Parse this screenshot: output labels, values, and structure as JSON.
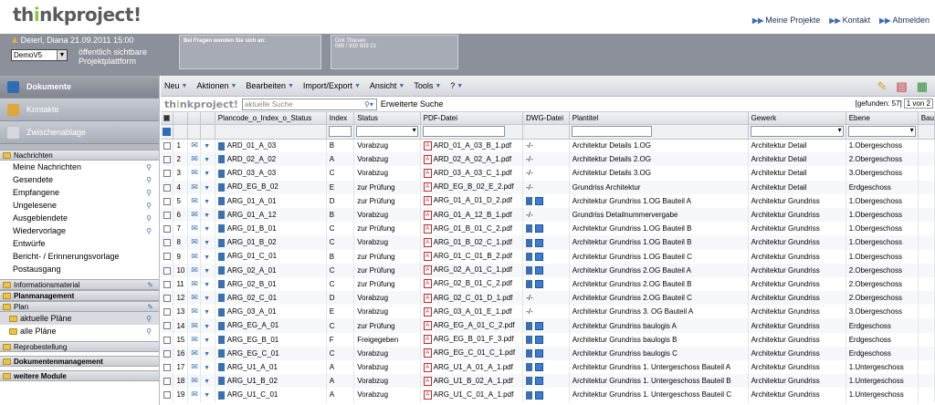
{
  "app": {
    "logo_prefix": "th",
    "logo_mid": "i",
    "logo_suffix": "nkproject!"
  },
  "top_links": [
    "Meine Projekte",
    "Kontakt",
    "Abmelden"
  ],
  "user": {
    "name": "Deierl, Diana",
    "datetime": "21.09.2011 15:00",
    "project_select": "DemoV5",
    "visibility_line1": "öffentlich sichtbare",
    "visibility_line2": "Projektplattform"
  },
  "info_boxes": {
    "questions": "Bei Fragen wenden Sie sich an:",
    "contact_name": "Dirk Thiesen",
    "contact_phone": "089 / 930 839 21"
  },
  "sidebar": {
    "big_nav": [
      {
        "label": "Dokumente",
        "active": true
      },
      {
        "label": "Kontakte",
        "active": false
      },
      {
        "label": "Zwischenablage",
        "active": false
      }
    ],
    "nachrichten": {
      "title": "Nachrichten",
      "items": [
        "Meine Nachrichten",
        "Gesendete",
        "Empfangene",
        "Ungelesene",
        "Ausgeblendete",
        "Wiedervorlage",
        "Entwürfe",
        "Bericht- / Erinnerungsvorlage",
        "Postausgang"
      ]
    },
    "sections": [
      "Informationsmaterial",
      "Planmanagement",
      "Plan"
    ],
    "plan_items": [
      "aktuelle Pläne",
      "alle Pläne"
    ],
    "bottom_sections": [
      "Reprobestellung",
      "Dokumentenmanagement",
      "weitere Module"
    ]
  },
  "menu": [
    "Neu",
    "Aktionen",
    "Bearbeiten",
    "Import/Export",
    "Ansicht",
    "Tools",
    "?"
  ],
  "search": {
    "placeholder": "aktuelle Suche",
    "advanced": "Erweiterte Suche",
    "found": "[gefunden: 57]",
    "page": "1 von 2"
  },
  "table": {
    "headers": [
      "Plancode_o_Index_o_Status",
      "Index",
      "Status",
      "PDF-Datei",
      "DWG-Datei",
      "Plantitel",
      "Gewerk",
      "Ebene",
      "Bau"
    ],
    "rows": [
      {
        "n": "1",
        "code": "ARD_01_A_03",
        "idx": "B",
        "status": "Vorabzug",
        "pdf": "ARD_01_A_03_B_1.pdf",
        "dwg": "-/-",
        "title": "Architektur Details 1.OG",
        "gewerk": "Architektur Detail",
        "ebene": "1.Obergeschoss"
      },
      {
        "n": "2",
        "code": "ARD_02_A_02",
        "idx": "A",
        "status": "Vorabzug",
        "pdf": "ARD_02_A_02_A_1.pdf",
        "dwg": "-/-",
        "title": "Architektur Details 2.OG",
        "gewerk": "Architektur Detail",
        "ebene": "2.Obergeschoss"
      },
      {
        "n": "3",
        "code": "ARD_03_A_03",
        "idx": "C",
        "status": "Vorabzug",
        "pdf": "ARD_03_A_03_C_1.pdf",
        "dwg": "-/-",
        "title": "Architektur Details 3.OG",
        "gewerk": "Architektur Detail",
        "ebene": "3.Obergeschoss"
      },
      {
        "n": "4",
        "code": "ARD_EG_B_02",
        "idx": "E",
        "status": "zur Prüfung",
        "pdf": "ARD_EG_B_02_E_2.pdf",
        "dwg": "-/-",
        "title": "Grundriss Architektur",
        "gewerk": "Architektur Detail",
        "ebene": "Erdgeschoss"
      },
      {
        "n": "5",
        "code": "ARG_01_A_01",
        "idx": "D",
        "status": "zur Prüfung",
        "pdf": "ARG_01_A_01_D_2.pdf",
        "dwg": "",
        "title": "Architektur Grundriss 1.OG Bauteil A",
        "gewerk": "Architektur Grundriss",
        "ebene": "1.Obergeschoss"
      },
      {
        "n": "6",
        "code": "ARG_01_A_12",
        "idx": "B",
        "status": "Vorabzug",
        "pdf": "ARG_01_A_12_B_1.pdf",
        "dwg": "-/-",
        "title": "Grundriss Detailnummervergabe",
        "gewerk": "Architektur Grundriss",
        "ebene": "1.Obergeschoss"
      },
      {
        "n": "7",
        "code": "ARG_01_B_01",
        "idx": "C",
        "status": "zur Prüfung",
        "pdf": "ARG_01_B_01_C_2.pdf",
        "dwg": "",
        "title": "Architektur Grundriss 1.OG Bauteil B",
        "gewerk": "Architektur Grundriss",
        "ebene": "1.Obergeschoss"
      },
      {
        "n": "8",
        "code": "ARG_01_B_02",
        "idx": "C",
        "status": "Vorabzug",
        "pdf": "ARG_01_B_02_C_1.pdf",
        "dwg": "",
        "title": "Architektur Grundriss 1.OG Bauteil B",
        "gewerk": "Architektur Grundriss",
        "ebene": "1.Obergeschoss"
      },
      {
        "n": "9",
        "code": "ARG_01_C_01",
        "idx": "B",
        "status": "zur Prüfung",
        "pdf": "ARG_01_C_01_B_2.pdf",
        "dwg": "",
        "title": "Architektur Grundriss 1.OG Bauteil C",
        "gewerk": "Architektur Grundriss",
        "ebene": "1.Obergeschoss"
      },
      {
        "n": "10",
        "code": "ARG_02_A_01",
        "idx": "C",
        "status": "zur Prüfung",
        "pdf": "ARG_02_A_01_C_1.pdf",
        "dwg": "",
        "title": "Architektur Grundriss 2.OG Bauteil A",
        "gewerk": "Architektur Grundriss",
        "ebene": "2.Obergeschoss"
      },
      {
        "n": "11",
        "code": "ARG_02_B_01",
        "idx": "C",
        "status": "zur Prüfung",
        "pdf": "ARG_02_B_01_C_2.pdf",
        "dwg": "",
        "title": "Architektur Grundriss 2.OG Bauteil B",
        "gewerk": "Architektur Grundriss",
        "ebene": "2.Obergeschoss"
      },
      {
        "n": "12",
        "code": "ARG_02_C_01",
        "idx": "D",
        "status": "Vorabzug",
        "pdf": "ARG_02_C_01_D_1.pdf",
        "dwg": "-/-",
        "title": "Architektur Grundriss 2.OG Bauteil C",
        "gewerk": "Architektur Grundriss",
        "ebene": "2.Obergeschoss"
      },
      {
        "n": "13",
        "code": "ARG_03_A_01",
        "idx": "E",
        "status": "Vorabzug",
        "pdf": "ARG_03_A_01_E_1.pdf",
        "dwg": "-/-",
        "title": "Architektur Grundriss 3. OG Bauteil A",
        "gewerk": "Architektur Grundriss",
        "ebene": "3.Obergeschoss"
      },
      {
        "n": "14",
        "code": "ARG_EG_A_01",
        "idx": "C",
        "status": "zur Prüfung",
        "pdf": "ARG_EG_A_01_C_2.pdf",
        "dwg": "",
        "title": "Architektur Grundriss baulogis A",
        "gewerk": "Architektur Grundriss",
        "ebene": "Erdgeschoss"
      },
      {
        "n": "15",
        "code": "ARG_EG_B_01",
        "idx": "F",
        "status": "Freigegeben",
        "pdf": "ARG_EG_B_01_F_3.pdf",
        "dwg": "",
        "title": "Architektur Grundriss baulogis B",
        "gewerk": "Architektur Grundriss",
        "ebene": "Erdgeschoss"
      },
      {
        "n": "16",
        "code": "ARG_EG_C_01",
        "idx": "C",
        "status": "Vorabzug",
        "pdf": "ARG_EG_C_01_C_1.pdf",
        "dwg": "",
        "title": "Architektur Grundriss baulogis C",
        "gewerk": "Architektur Grundriss",
        "ebene": "Erdgeschoss"
      },
      {
        "n": "17",
        "code": "ARG_U1_A_01",
        "idx": "A",
        "status": "Vorabzug",
        "pdf": "ARG_U1_A_01_A_1.pdf",
        "dwg": "",
        "title": "Architektur Grundriss 1. Untergeschoss Bauteil A",
        "gewerk": "Architektur Grundriss",
        "ebene": "1.Untergeschoss"
      },
      {
        "n": "18",
        "code": "ARG_U1_B_02",
        "idx": "A",
        "status": "Vorabzug",
        "pdf": "ARG_U1_B_02_A_1.pdf",
        "dwg": "",
        "title": "Architektur Grundriss 1. Untergeschoss Bauteil B",
        "gewerk": "Architektur Grundriss",
        "ebene": "1.Untergeschoss"
      },
      {
        "n": "19",
        "code": "ARG_U1_C_01",
        "idx": "A",
        "status": "Vorabzug",
        "pdf": "ARG_U1_C_01_A_1.pdf",
        "dwg": "",
        "title": "Architektur Grundriss 1. Untergeschoss Bauteil C",
        "gewerk": "Architektur Grundriss",
        "ebene": "1.Untergeschoss"
      }
    ]
  }
}
